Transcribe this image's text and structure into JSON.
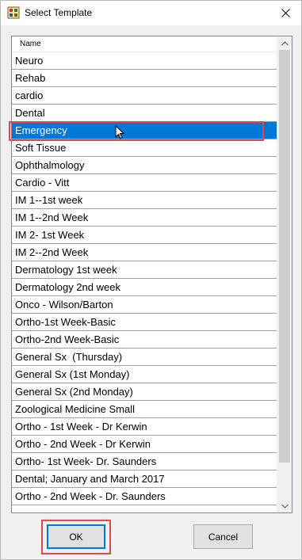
{
  "window": {
    "title": "Select Template"
  },
  "list": {
    "column_header": "Name",
    "items": [
      "Neuro",
      "Rehab",
      "cardio",
      "Dental",
      "Emergency",
      "Soft Tissue",
      "Ophthalmology",
      "Cardio - Vitt",
      "IM 1--1st week",
      "IM 1--2nd Week",
      "IM 2- 1st Week",
      "IM 2--2nd Week",
      "Dermatology 1st week",
      "Dermatology 2nd week",
      "Onco - Wilson/Barton",
      "Ortho-1st Week-Basic",
      "Ortho-2nd Week-Basic",
      "General Sx  (Thursday)",
      "General Sx (1st Monday)",
      "General Sx (2nd Monday)",
      "Zoological Medicine Small",
      "Ortho - 1st Week - Dr Kerwin",
      "Ortho - 2nd Week - Dr Kerwin",
      "Ortho- 1st Week- Dr. Saunders",
      "Dental; January and March 2017",
      "Ortho - 2nd Week - Dr. Saunders"
    ],
    "selected_index": 4
  },
  "buttons": {
    "ok": "OK",
    "cancel": "Cancel"
  },
  "colors": {
    "selection": "#0078d7",
    "annotation": "#e0484c"
  }
}
